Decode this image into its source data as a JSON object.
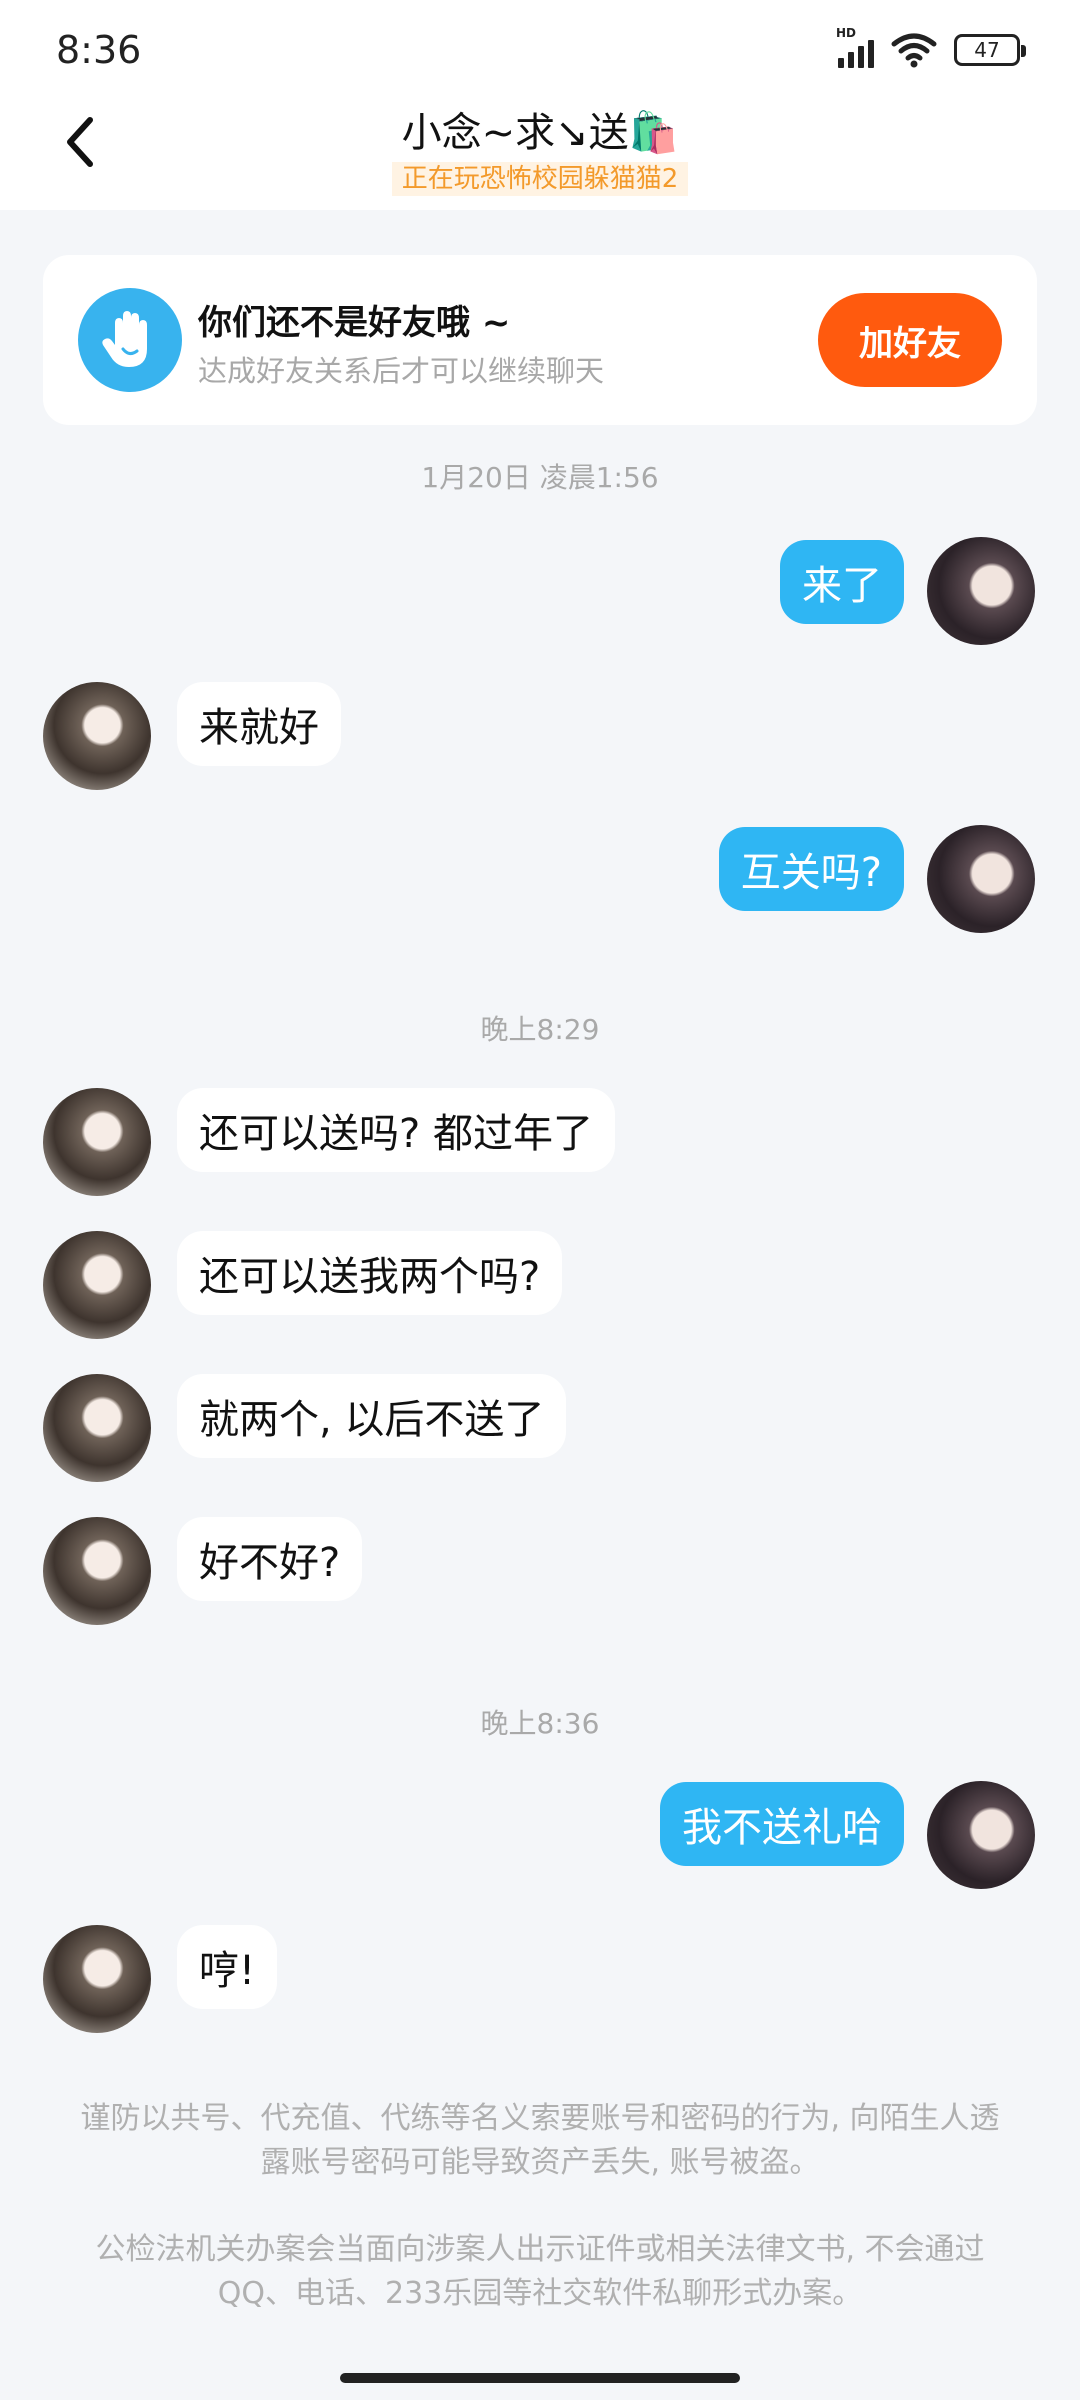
{
  "status_bar": {
    "time": "8:36",
    "network": "HD",
    "battery": "47"
  },
  "header": {
    "title": "小念~求↘送🛍️",
    "subtitle": "正在玩恐怖校园躲猫猫2"
  },
  "banner": {
    "title": "你们还不是好友哦 ~",
    "subtitle": "达成好友关系后才可以继续聊天",
    "add_button": "加好友"
  },
  "messages": [
    {
      "type": "time",
      "text": "1月20日 凌晨1:56"
    },
    {
      "type": "msg",
      "from": "me",
      "text": "来了"
    },
    {
      "type": "msg",
      "from": "her",
      "text": "来就好"
    },
    {
      "type": "msg",
      "from": "me",
      "text": "互关吗?"
    },
    {
      "type": "time",
      "text": "晚上8:29"
    },
    {
      "type": "msg",
      "from": "her",
      "text": "还可以送吗? 都过年了"
    },
    {
      "type": "msg",
      "from": "her",
      "text": "还可以送我两个吗?"
    },
    {
      "type": "msg",
      "from": "her",
      "text": "就两个, 以后不送了"
    },
    {
      "type": "msg",
      "from": "her",
      "text": "好不好?"
    },
    {
      "type": "time",
      "text": "晚上8:36"
    },
    {
      "type": "msg",
      "from": "me",
      "text": "我不送礼哈"
    },
    {
      "type": "msg",
      "from": "her",
      "text": "哼!"
    }
  ],
  "notices": [
    "谨防以共号、代充值、代练等名义索要账号和密码的行为, 向陌生人透露账号密码可能导致资产丢失, 账号被盗。",
    "公检法机关办案会当面向涉案人出示证件或相关法律文书, 不会通过QQ、电话、233乐园等社交软件私聊形式办案。"
  ],
  "colors": {
    "my_bubble": "#2fb6f3",
    "add_button": "#ff5a0e",
    "subtitle": "#f39a2b"
  }
}
